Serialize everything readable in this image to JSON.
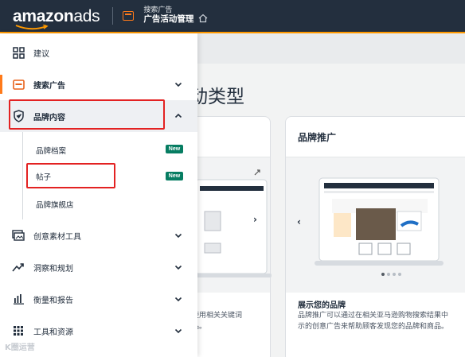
{
  "header": {
    "logo_bold": "amazon",
    "logo_light": "ads",
    "crumb_parent": "搜索广告",
    "crumb_current": "广告活动管理"
  },
  "colors": {
    "topbar": "#232f3e",
    "accent": "#ff9900",
    "highlight": "#e32222",
    "badge": "#067d62"
  },
  "background": {
    "heading": "动类型",
    "card_left": {
      "desc_lines": [
        "使用相关关键词",
        "品。"
      ]
    },
    "card_right": {
      "title": "品牌推广",
      "subtitle": "展示您的品牌",
      "desc_lines": [
        "品牌推广可以通过在相关亚马逊购物搜索结果中",
        "示的创意广告来帮助顾客发现您的品牌和商品。"
      ]
    }
  },
  "sidebar": {
    "items": [
      {
        "label": "建议",
        "icon": "dashboard-icon"
      },
      {
        "label": "搜索广告",
        "icon": "ad-campaign-icon",
        "expanded": false
      },
      {
        "label": "品牌内容",
        "icon": "shield-icon",
        "expanded": true
      },
      {
        "label": "创意素材工具",
        "icon": "media-icon",
        "expanded": false
      },
      {
        "label": "洞察和规划",
        "icon": "trend-icon",
        "expanded": false
      },
      {
        "label": "衡量和报告",
        "icon": "bar-chart-icon",
        "expanded": false
      },
      {
        "label": "工具和资源",
        "icon": "grid-icon",
        "expanded": false
      }
    ],
    "subitems": [
      {
        "label": "品牌档案",
        "badge": "New"
      },
      {
        "label": "帖子",
        "badge": "New"
      },
      {
        "label": "品牌旗舰店",
        "badge": ""
      }
    ]
  },
  "watermark": "K圈运营"
}
